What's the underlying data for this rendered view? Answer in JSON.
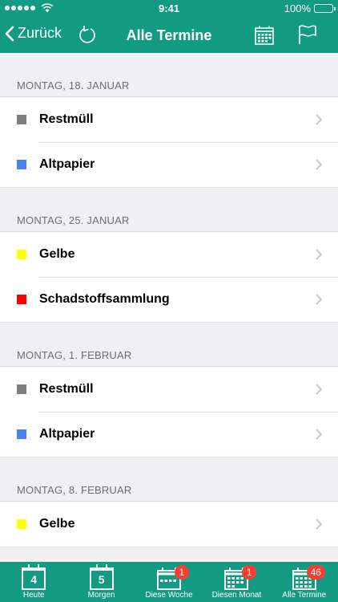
{
  "status_bar": {
    "time": "9:41",
    "battery": "100%"
  },
  "nav": {
    "back_label": "Zurück",
    "title": "Alle Termine"
  },
  "sections": [
    {
      "header": "MONTAG, 18. JANUAR",
      "rows": [
        {
          "label": "Restmüll",
          "color": "#7f7f7f"
        },
        {
          "label": "Altpapier",
          "color": "#4f7ff5"
        }
      ]
    },
    {
      "header": "MONTAG, 25. JANUAR",
      "rows": [
        {
          "label": "Gelbe",
          "color": "#ffff00"
        },
        {
          "label": "Schadstoffsammlung",
          "color": "#ff0000"
        }
      ]
    },
    {
      "header": "MONTAG, 1. FEBRUAR",
      "rows": [
        {
          "label": "Restmüll",
          "color": "#7f7f7f"
        },
        {
          "label": "Altpapier",
          "color": "#4f7ff5"
        }
      ]
    },
    {
      "header": "MONTAG, 8. FEBRUAR",
      "rows": [
        {
          "label": "Gelbe",
          "color": "#ffff00"
        }
      ]
    }
  ],
  "tabbar": {
    "heute": {
      "label": "Heute",
      "number": "4"
    },
    "morgen": {
      "label": "Morgen",
      "number": "5"
    },
    "woche": {
      "label": "Diese Woche",
      "badge": "1"
    },
    "monat": {
      "label": "Diesen Monat",
      "badge": "1"
    },
    "alle": {
      "label": "Alle Termine",
      "badge": "46"
    }
  },
  "colors": {
    "accent": "#139a83",
    "badge": "#ff3b30"
  }
}
